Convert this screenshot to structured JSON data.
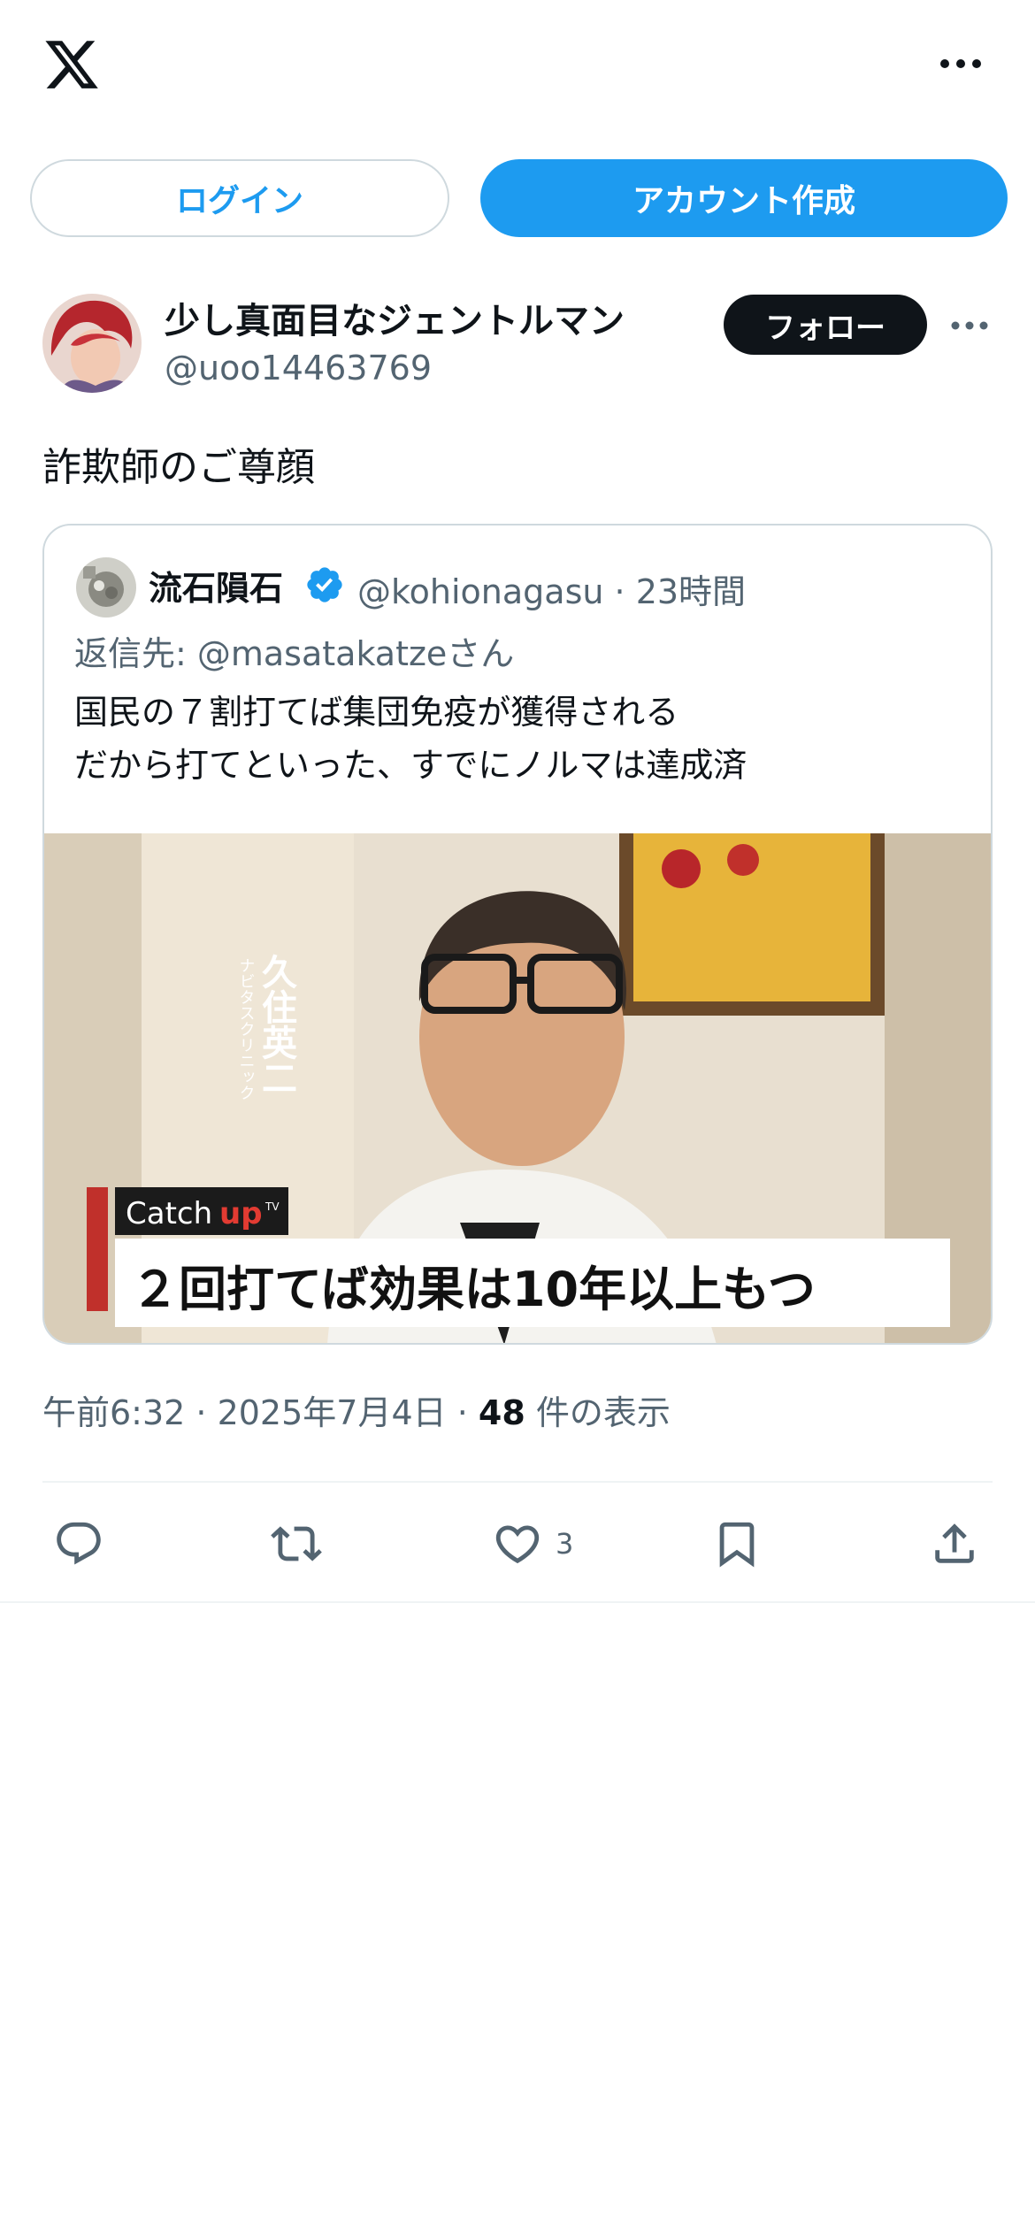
{
  "colors": {
    "accent": "#1d9bf0",
    "text": "#0f1419",
    "muted": "#536471",
    "border": "#cfd9de"
  },
  "header": {
    "logo_icon": "x-logo-icon",
    "more_icon": "more-horizontal-icon"
  },
  "auth": {
    "login_label": "ログイン",
    "signup_label": "アカウント作成"
  },
  "tweet": {
    "author_name": "少し真面目なジェントルマン",
    "author_handle": "@uoo14463769",
    "follow_label": "フォロー",
    "text": "詐欺師のご尊顔",
    "quote": {
      "name": "流石隕石",
      "handle_time": "@kohionagasu · 23時間",
      "reply_to": "返信先: @masatakatzeさん",
      "lines": [
        "国民の７割打てば集団免疫が獲得される",
        "だから打てといった、すでにノルマは達成済"
      ],
      "media": {
        "caption": "２回打てば効果は10年以上もつ",
        "brand_prefix": "Catch",
        "brand_suffix": "up",
        "brand_tm": "TV",
        "person_name": "久住英二",
        "clinic": "ナビタスクリニック"
      }
    },
    "meta": {
      "time": "午前6:32 · 2025年7月4日 · ",
      "views": "48",
      "views_label": " 件の表示"
    },
    "actions": {
      "like_count": "3"
    }
  }
}
